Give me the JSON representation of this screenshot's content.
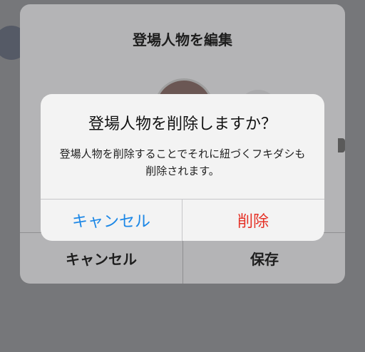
{
  "edit_sheet": {
    "title": "登場人物を編集",
    "cancel_label": "キャンセル",
    "save_label": "保存"
  },
  "alert": {
    "title": "登場人物を削除しますか？",
    "message": "登場人物を削除することでそれに紐づくフキダシも削除されます。",
    "cancel_label": "キャンセル",
    "delete_label": "削除"
  },
  "colors": {
    "cancel_blue": "#1a86e6",
    "destructive_red": "#e53126"
  }
}
